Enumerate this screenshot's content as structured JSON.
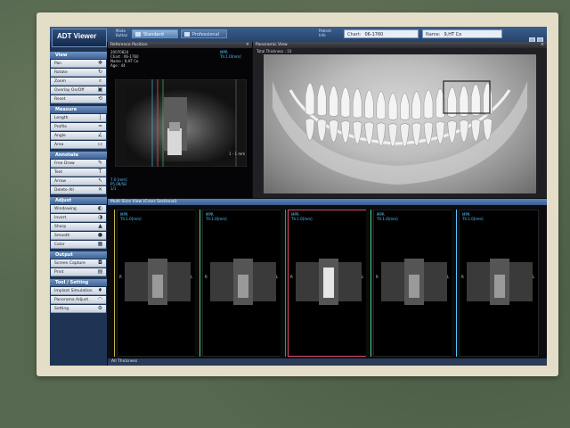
{
  "app": {
    "logo": "ADT Viewer",
    "mode_label": "Mode Button",
    "modes": [
      {
        "label": "Standard",
        "active": true
      },
      {
        "label": "Professional",
        "active": false
      }
    ],
    "patient_label": "Patient Info",
    "chart_key": "Chart:",
    "chart_value": "06-1760",
    "name_key": "Name:",
    "name_value": "9,HT Co"
  },
  "sidebar": {
    "sections": [
      {
        "title": "View",
        "tools": [
          {
            "label": "Pan",
            "icon": "move-icon"
          },
          {
            "label": "Rotate",
            "icon": "rotate-icon"
          },
          {
            "label": "Zoom",
            "icon": "zoom-icon"
          },
          {
            "label": "Overlay On/Off",
            "icon": "overlay-icon"
          },
          {
            "label": "Reset",
            "icon": "reset-icon"
          }
        ]
      },
      {
        "title": "Measure",
        "tools": [
          {
            "label": "Length",
            "icon": "length-icon"
          },
          {
            "label": "Profile",
            "icon": "profile-icon"
          },
          {
            "label": "Angle",
            "icon": "angle-icon"
          },
          {
            "label": "Area",
            "icon": "area-icon"
          }
        ]
      },
      {
        "title": "Annotate",
        "tools": [
          {
            "label": "Free Draw",
            "icon": "pen-icon"
          },
          {
            "label": "Text",
            "icon": "text-icon"
          },
          {
            "label": "Arrow",
            "icon": "arrow-icon"
          },
          {
            "label": "Delete All",
            "icon": "delete-icon"
          }
        ]
      },
      {
        "title": "Adjust",
        "tools": [
          {
            "label": "Windowing",
            "icon": "windowing-icon"
          },
          {
            "label": "Invert",
            "icon": "invert-icon"
          },
          {
            "label": "Sharp",
            "icon": "sharp-icon"
          },
          {
            "label": "Smooth",
            "icon": "smooth-icon"
          },
          {
            "label": "Color",
            "icon": "color-icon"
          }
        ]
      },
      {
        "title": "Output",
        "tools": [
          {
            "label": "Screen Capture",
            "icon": "camera-icon"
          },
          {
            "label": "Print",
            "icon": "print-icon"
          }
        ]
      },
      {
        "title": "Tool / Setting",
        "tools": [
          {
            "label": "Implant Simulation",
            "icon": "implant-icon"
          },
          {
            "label": "Panorama Adjust",
            "icon": "panorama-icon"
          },
          {
            "label": "Setting",
            "icon": "gear-icon"
          }
        ]
      }
    ]
  },
  "reference": {
    "title": "Reference Position",
    "info": "20070824\nChart : 06-1760\nName : 9,HT Co\nAge : 44",
    "mpr": "MPR\nTh:1.0[mm]",
    "bottom": "7.0 [mm]\nP5.09/58\n1/1",
    "side_label": "1 - 1 mm"
  },
  "panorama": {
    "title": "Panoramic View",
    "sub": "Total Thickness : 10"
  },
  "multi": {
    "title": "Multi Slice View (Cross Sectional)",
    "slices": [
      {
        "label": "MPR\nTh:1.0[mm]",
        "left": "R",
        "right": "L"
      },
      {
        "label": "MPR\nTh:1.0[mm]",
        "left": "R",
        "right": "L"
      },
      {
        "label": "MPR\nTh:1.0[mm]",
        "left": "R",
        "right": "L"
      },
      {
        "label": "MPR\nTh:1.0[mm]",
        "left": "R",
        "right": "L"
      },
      {
        "label": "MPR\nTh:1.0[mm]",
        "left": "R",
        "right": "L"
      }
    ],
    "bottom": "All Thickness"
  }
}
